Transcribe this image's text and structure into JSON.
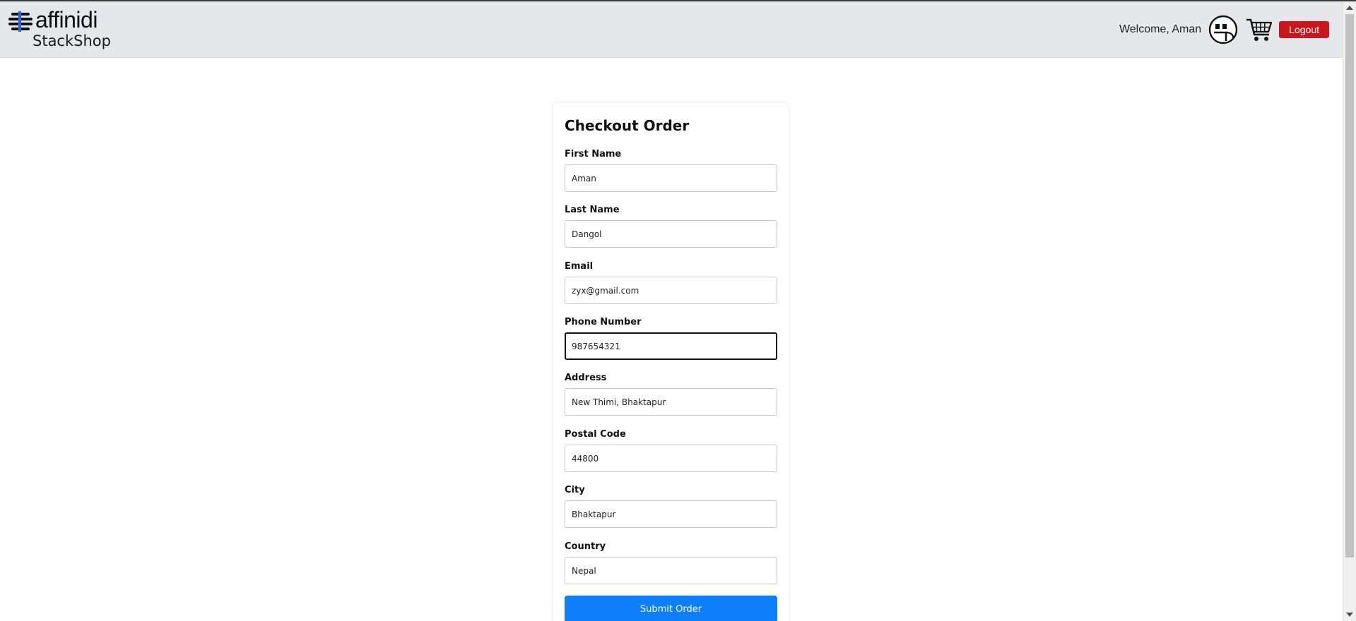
{
  "header": {
    "brand": "affinidi",
    "app_name": "StackShop",
    "welcome_text": "Welcome, Aman",
    "logout_label": "Logout",
    "logout_color": "#c8181e",
    "background": "#e6e7ea"
  },
  "icons": {
    "brand_logo": "affinidi-logo-icon",
    "avatar": "avatar-face-icon",
    "cart": "shopping-cart-icon"
  },
  "checkout": {
    "title": "Checkout Order",
    "fields": [
      {
        "label": "First Name",
        "value": "Aman"
      },
      {
        "label": "Last Name",
        "value": "Dangol"
      },
      {
        "label": "Email",
        "value": "zyx@gmail.com"
      },
      {
        "label": "Phone Number",
        "value": "987654321",
        "focused": true
      },
      {
        "label": "Address",
        "value": "New Thimi, Bhaktapur"
      },
      {
        "label": "Postal Code",
        "value": "44800"
      },
      {
        "label": "City",
        "value": "Bhaktapur"
      },
      {
        "label": "Country",
        "value": "Nepal"
      }
    ],
    "submit_label": "Submit Order",
    "submit_color": "#0d7ffb"
  }
}
